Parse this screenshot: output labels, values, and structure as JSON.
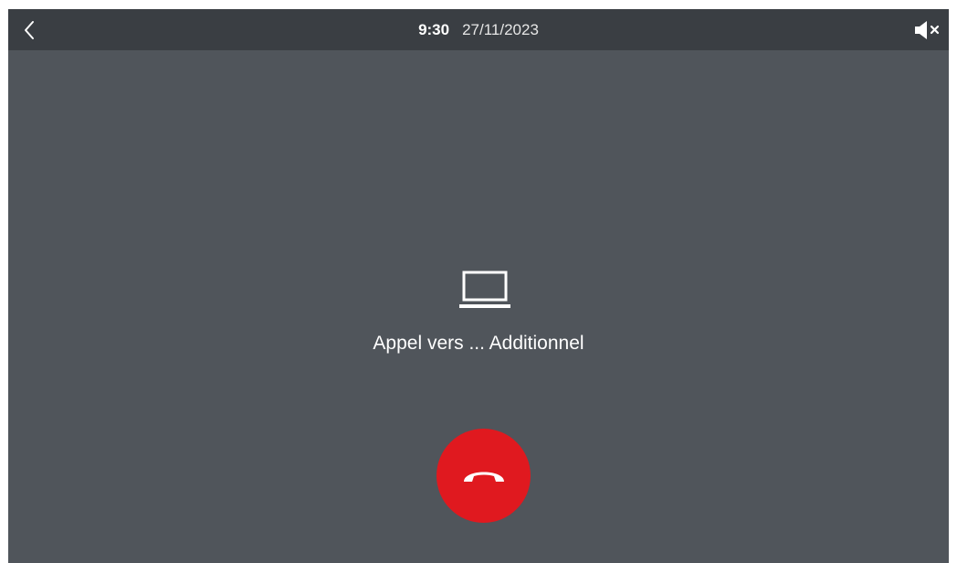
{
  "status_bar": {
    "time": "9:30",
    "date": "27/11/2023"
  },
  "icons": {
    "back": "chevron-left-icon",
    "mute": "speaker-muted-icon",
    "device": "monitor-icon",
    "hangup": "phone-hangup-icon"
  },
  "call": {
    "label": "Appel vers ... Additionnel"
  },
  "colors": {
    "background": "#50555b",
    "topbar": "#3a3e43",
    "hangup": "#e0191f",
    "text": "#ffffff"
  }
}
